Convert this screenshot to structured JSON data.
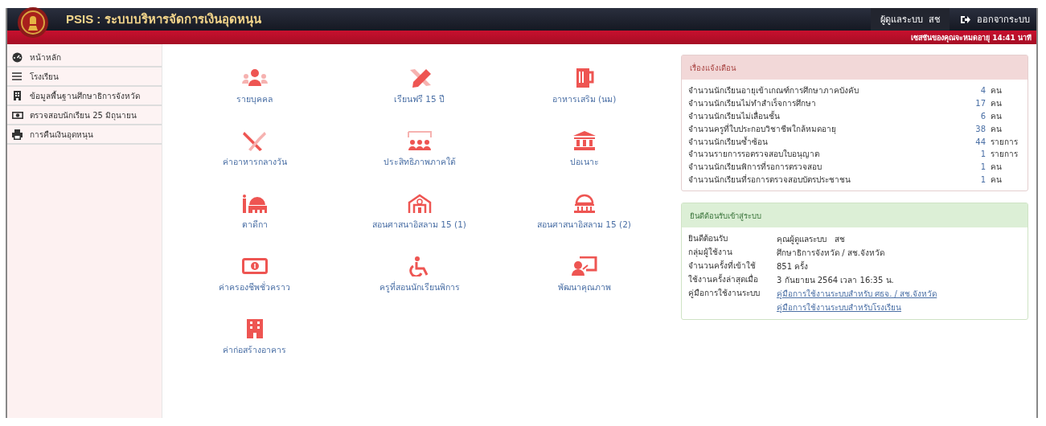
{
  "header": {
    "title": "PSIS : ระบบบริหารจัดการเงินอุดหนุน",
    "user": "ผู้ดูแลระบบ  สช",
    "logout": "ออกจากระบบ",
    "session": "เซสชันของคุณจะหมดอายุ 14:41 นาที"
  },
  "sidebar": {
    "items": [
      {
        "label": "หน้าหลัก"
      },
      {
        "label": "โรงเรียน"
      },
      {
        "label": "ข้อมูลพื้นฐานศึกษาธิการจังหวัด"
      },
      {
        "label": "ตรวจสอบนักเรียน 25 มิถุนายน"
      },
      {
        "label": "การคืนเงินอุดหนุน"
      }
    ]
  },
  "menu": [
    {
      "label": "รายบุคคล"
    },
    {
      "label": "เรียนฟรี 15 ปี"
    },
    {
      "label": "อาหารเสริม (นม)"
    },
    {
      "label": "ค่าอาหารกลางวัน"
    },
    {
      "label": "ประสิทธิภาพภาคใต้"
    },
    {
      "label": "ปอเนาะ"
    },
    {
      "label": "ตาดีกา"
    },
    {
      "label": "สอนศาสนาอิสลาม 15 (1)"
    },
    {
      "label": "สอนศาสนาอิสลาม 15 (2)"
    },
    {
      "label": "ค่าครองชีพชั่วคราว"
    },
    {
      "label": "ครูที่สอนนักเรียนพิการ"
    },
    {
      "label": "พัฒนาคุณภาพ"
    },
    {
      "label": "ค่าก่อสร้างอาคาร"
    }
  ],
  "alerts": {
    "title": "เรื่องแจ้งเตือน",
    "rows": [
      {
        "label": "จำนวนนักเรียนอายุเข้าเกณฑ์การศึกษาภาคบังคับ",
        "count": "4",
        "unit": "คน"
      },
      {
        "label": "จำนวนนักเรียนไม่ทำสำเร็จการศึกษา",
        "count": "17",
        "unit": "คน"
      },
      {
        "label": "จำนวนนักเรียนไม่เลื่อนชั้น",
        "count": "6",
        "unit": "คน"
      },
      {
        "label": "จำนวนครูที่ใบประกอบวิชาชีพใกล้หมดอายุ",
        "count": "38",
        "unit": "คน"
      },
      {
        "label": "จำนวนนักเรียนซ้ำซ้อน",
        "count": "44",
        "unit": "รายการ"
      },
      {
        "label": "จำนวนรายการรอตรวจสอบใบอนุญาต",
        "count": "1",
        "unit": "รายการ"
      },
      {
        "label": "จำนวนนักเรียนพิการที่รอการตรวจสอบ",
        "count": "1",
        "unit": "คน"
      },
      {
        "label": "จำนวนนักเรียนที่รอการตรวจสอบบัตรประชาชน",
        "count": "1",
        "unit": "คน"
      }
    ]
  },
  "welcome": {
    "title": "ยินดีต้อนรับเข้าสู่ระบบ",
    "rows": [
      {
        "label": "ยินดีต้อนรับ",
        "values": [
          {
            "kind": "text",
            "text": "คุณผู้ดูแลระบบ   สช"
          }
        ]
      },
      {
        "label": "กลุ่มผู้ใช้งาน",
        "values": [
          {
            "kind": "text",
            "text": "ศึกษาธิการจังหวัด / สช.จังหวัด"
          }
        ]
      },
      {
        "label": "จำนวนครั้งที่เข้าใช้",
        "values": [
          {
            "kind": "text",
            "text": "851 ครั้ง"
          }
        ]
      },
      {
        "label": "ใช้งานครั้งล่าสุดเมื่อ",
        "values": [
          {
            "kind": "text",
            "text": "3 กันยายน 2564 เวลา 16:35 น."
          }
        ]
      },
      {
        "label": "คู่มือการใช้งานระบบ",
        "values": [
          {
            "kind": "link",
            "text": "คู่มือการใช้งานระบบสำหรับ ศธจ. / สช.จังหวัด"
          },
          {
            "kind": "link",
            "text": "คู่มือการใช้งานระบบสำหรับโรงเรียน"
          }
        ]
      }
    ]
  }
}
